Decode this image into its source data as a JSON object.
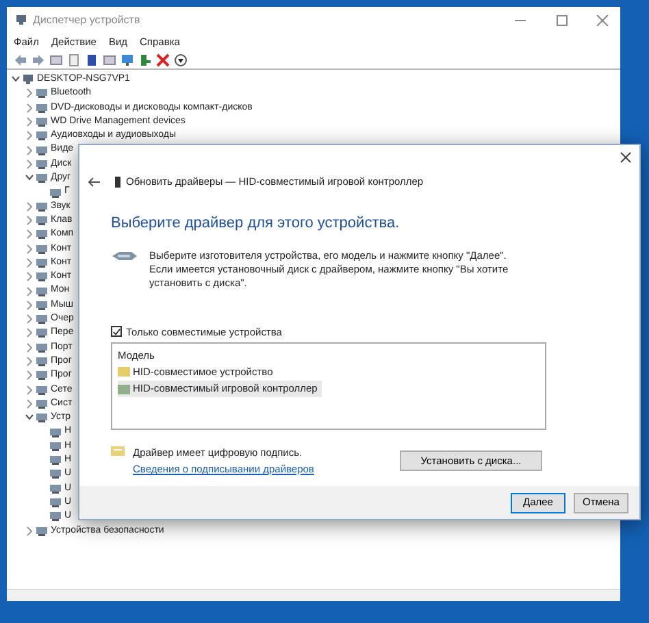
{
  "window": {
    "title": "Диспетчер устройств"
  },
  "menu": [
    "Файл",
    "Действие",
    "Вид",
    "Справка"
  ],
  "tree": {
    "label": "DESKTOP-NSG7VP1",
    "expanded": true,
    "children": [
      {
        "label": "Bluetooth",
        "expanded": false
      },
      {
        "label": "DVD-дисководы и дисководы компакт-дисков",
        "expanded": false
      },
      {
        "label": "WD Drive Management devices",
        "expanded": false
      },
      {
        "label": "Аудиовходы и аудиовыходы",
        "expanded": false
      },
      {
        "label": "Виде",
        "expanded": false
      },
      {
        "label": "Диск",
        "expanded": false
      },
      {
        "label": "Друг",
        "expanded": true,
        "children": [
          {
            "label": "Г"
          }
        ]
      },
      {
        "label": "Звук",
        "expanded": false
      },
      {
        "label": "Клав",
        "expanded": false
      },
      {
        "label": "Комп",
        "expanded": false
      },
      {
        "label": "Конт",
        "expanded": false
      },
      {
        "label": "Конт",
        "expanded": false
      },
      {
        "label": "Конт",
        "expanded": false
      },
      {
        "label": "Мон",
        "expanded": false
      },
      {
        "label": "Мыш",
        "expanded": false
      },
      {
        "label": "Очер",
        "expanded": false
      },
      {
        "label": "Пере",
        "expanded": false
      },
      {
        "label": "Порт",
        "expanded": false
      },
      {
        "label": "Прог",
        "expanded": false
      },
      {
        "label": "Прог",
        "expanded": false
      },
      {
        "label": "Сете",
        "expanded": false
      },
      {
        "label": "Сист",
        "expanded": false
      },
      {
        "label": "Устр",
        "expanded": true,
        "children": [
          {
            "label": "H"
          },
          {
            "label": "H"
          },
          {
            "label": "H"
          },
          {
            "label": "U"
          },
          {
            "label": "U"
          },
          {
            "label": "U"
          },
          {
            "label": "U"
          }
        ]
      },
      {
        "label": "Устройства безопасности",
        "expanded": false
      }
    ]
  },
  "dialog": {
    "title": "Обновить драйверы — HID-совместимый игровой контроллер",
    "heading": "Выберите драйвер для этого устройства.",
    "description": "Выберите изготовителя устройства, его модель и нажмите кнопку \"Далее\". Если имеется установочный диск с  драйвером, нажмите кнопку \"Вы хотите установить с диска\".",
    "compatible_only": {
      "label": "Только совместимые устройства",
      "checked": true
    },
    "model_list": {
      "header": "Модель",
      "items": [
        {
          "label": "HID-совместимое устройство",
          "selected": false
        },
        {
          "label": "HID-совместимый игровой контроллер",
          "selected": true
        }
      ]
    },
    "signature_note": "Драйвер имеет цифровую подпись.",
    "signature_link": "Сведения о подписывании драйверов",
    "install_button": "Установить с диска...",
    "buttons": [
      {
        "label": "Далее",
        "default": true
      },
      {
        "label": "Отмена",
        "default": false
      }
    ]
  }
}
